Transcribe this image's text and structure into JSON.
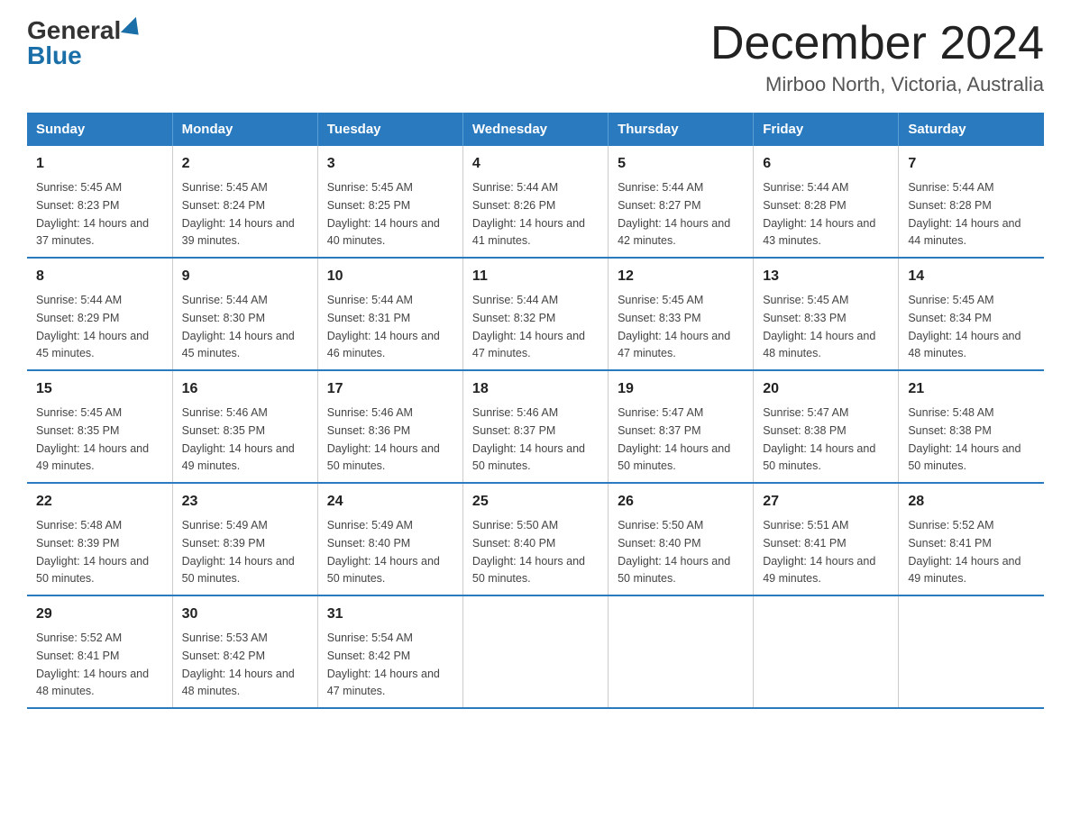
{
  "header": {
    "logo_general": "General",
    "logo_blue": "Blue",
    "month": "December 2024",
    "location": "Mirboo North, Victoria, Australia"
  },
  "days_of_week": [
    "Sunday",
    "Monday",
    "Tuesday",
    "Wednesday",
    "Thursday",
    "Friday",
    "Saturday"
  ],
  "weeks": [
    [
      {
        "day": 1,
        "sunrise": "5:45 AM",
        "sunset": "8:23 PM",
        "daylight": "14 hours and 37 minutes."
      },
      {
        "day": 2,
        "sunrise": "5:45 AM",
        "sunset": "8:24 PM",
        "daylight": "14 hours and 39 minutes."
      },
      {
        "day": 3,
        "sunrise": "5:45 AM",
        "sunset": "8:25 PM",
        "daylight": "14 hours and 40 minutes."
      },
      {
        "day": 4,
        "sunrise": "5:44 AM",
        "sunset": "8:26 PM",
        "daylight": "14 hours and 41 minutes."
      },
      {
        "day": 5,
        "sunrise": "5:44 AM",
        "sunset": "8:27 PM",
        "daylight": "14 hours and 42 minutes."
      },
      {
        "day": 6,
        "sunrise": "5:44 AM",
        "sunset": "8:28 PM",
        "daylight": "14 hours and 43 minutes."
      },
      {
        "day": 7,
        "sunrise": "5:44 AM",
        "sunset": "8:28 PM",
        "daylight": "14 hours and 44 minutes."
      }
    ],
    [
      {
        "day": 8,
        "sunrise": "5:44 AM",
        "sunset": "8:29 PM",
        "daylight": "14 hours and 45 minutes."
      },
      {
        "day": 9,
        "sunrise": "5:44 AM",
        "sunset": "8:30 PM",
        "daylight": "14 hours and 45 minutes."
      },
      {
        "day": 10,
        "sunrise": "5:44 AM",
        "sunset": "8:31 PM",
        "daylight": "14 hours and 46 minutes."
      },
      {
        "day": 11,
        "sunrise": "5:44 AM",
        "sunset": "8:32 PM",
        "daylight": "14 hours and 47 minutes."
      },
      {
        "day": 12,
        "sunrise": "5:45 AM",
        "sunset": "8:33 PM",
        "daylight": "14 hours and 47 minutes."
      },
      {
        "day": 13,
        "sunrise": "5:45 AM",
        "sunset": "8:33 PM",
        "daylight": "14 hours and 48 minutes."
      },
      {
        "day": 14,
        "sunrise": "5:45 AM",
        "sunset": "8:34 PM",
        "daylight": "14 hours and 48 minutes."
      }
    ],
    [
      {
        "day": 15,
        "sunrise": "5:45 AM",
        "sunset": "8:35 PM",
        "daylight": "14 hours and 49 minutes."
      },
      {
        "day": 16,
        "sunrise": "5:46 AM",
        "sunset": "8:35 PM",
        "daylight": "14 hours and 49 minutes."
      },
      {
        "day": 17,
        "sunrise": "5:46 AM",
        "sunset": "8:36 PM",
        "daylight": "14 hours and 50 minutes."
      },
      {
        "day": 18,
        "sunrise": "5:46 AM",
        "sunset": "8:37 PM",
        "daylight": "14 hours and 50 minutes."
      },
      {
        "day": 19,
        "sunrise": "5:47 AM",
        "sunset": "8:37 PM",
        "daylight": "14 hours and 50 minutes."
      },
      {
        "day": 20,
        "sunrise": "5:47 AM",
        "sunset": "8:38 PM",
        "daylight": "14 hours and 50 minutes."
      },
      {
        "day": 21,
        "sunrise": "5:48 AM",
        "sunset": "8:38 PM",
        "daylight": "14 hours and 50 minutes."
      }
    ],
    [
      {
        "day": 22,
        "sunrise": "5:48 AM",
        "sunset": "8:39 PM",
        "daylight": "14 hours and 50 minutes."
      },
      {
        "day": 23,
        "sunrise": "5:49 AM",
        "sunset": "8:39 PM",
        "daylight": "14 hours and 50 minutes."
      },
      {
        "day": 24,
        "sunrise": "5:49 AM",
        "sunset": "8:40 PM",
        "daylight": "14 hours and 50 minutes."
      },
      {
        "day": 25,
        "sunrise": "5:50 AM",
        "sunset": "8:40 PM",
        "daylight": "14 hours and 50 minutes."
      },
      {
        "day": 26,
        "sunrise": "5:50 AM",
        "sunset": "8:40 PM",
        "daylight": "14 hours and 50 minutes."
      },
      {
        "day": 27,
        "sunrise": "5:51 AM",
        "sunset": "8:41 PM",
        "daylight": "14 hours and 49 minutes."
      },
      {
        "day": 28,
        "sunrise": "5:52 AM",
        "sunset": "8:41 PM",
        "daylight": "14 hours and 49 minutes."
      }
    ],
    [
      {
        "day": 29,
        "sunrise": "5:52 AM",
        "sunset": "8:41 PM",
        "daylight": "14 hours and 48 minutes."
      },
      {
        "day": 30,
        "sunrise": "5:53 AM",
        "sunset": "8:42 PM",
        "daylight": "14 hours and 48 minutes."
      },
      {
        "day": 31,
        "sunrise": "5:54 AM",
        "sunset": "8:42 PM",
        "daylight": "14 hours and 47 minutes."
      },
      null,
      null,
      null,
      null
    ]
  ]
}
